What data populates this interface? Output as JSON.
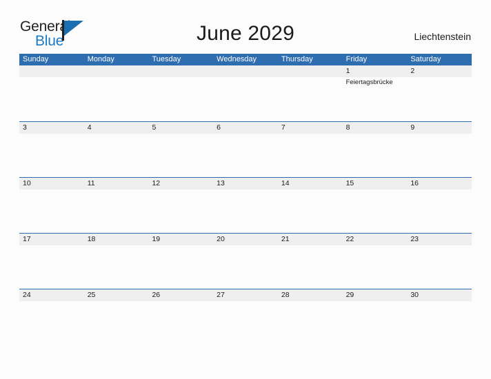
{
  "brand": {
    "name_part1": "General",
    "name_part2": "Blue",
    "flag_icon": "flag-triangle-icon"
  },
  "header": {
    "title": "June 2029",
    "region": "Liechtenstein"
  },
  "calendar": {
    "weekday_headers": [
      "Sunday",
      "Monday",
      "Tuesday",
      "Wednesday",
      "Thursday",
      "Friday",
      "Saturday"
    ],
    "accent_color": "#2e6daf",
    "band_color": "#efefef",
    "weeks": [
      [
        {
          "day": "",
          "events": []
        },
        {
          "day": "",
          "events": []
        },
        {
          "day": "",
          "events": []
        },
        {
          "day": "",
          "events": []
        },
        {
          "day": "",
          "events": []
        },
        {
          "day": "1",
          "events": [
            "Feiertagsbrücke"
          ]
        },
        {
          "day": "2",
          "events": []
        }
      ],
      [
        {
          "day": "3",
          "events": []
        },
        {
          "day": "4",
          "events": []
        },
        {
          "day": "5",
          "events": []
        },
        {
          "day": "6",
          "events": []
        },
        {
          "day": "7",
          "events": []
        },
        {
          "day": "8",
          "events": []
        },
        {
          "day": "9",
          "events": []
        }
      ],
      [
        {
          "day": "10",
          "events": []
        },
        {
          "day": "11",
          "events": []
        },
        {
          "day": "12",
          "events": []
        },
        {
          "day": "13",
          "events": []
        },
        {
          "day": "14",
          "events": []
        },
        {
          "day": "15",
          "events": []
        },
        {
          "day": "16",
          "events": []
        }
      ],
      [
        {
          "day": "17",
          "events": []
        },
        {
          "day": "18",
          "events": []
        },
        {
          "day": "19",
          "events": []
        },
        {
          "day": "20",
          "events": []
        },
        {
          "day": "21",
          "events": []
        },
        {
          "day": "22",
          "events": []
        },
        {
          "day": "23",
          "events": []
        }
      ],
      [
        {
          "day": "24",
          "events": []
        },
        {
          "day": "25",
          "events": []
        },
        {
          "day": "26",
          "events": []
        },
        {
          "day": "27",
          "events": []
        },
        {
          "day": "28",
          "events": []
        },
        {
          "day": "29",
          "events": []
        },
        {
          "day": "30",
          "events": []
        }
      ]
    ]
  }
}
